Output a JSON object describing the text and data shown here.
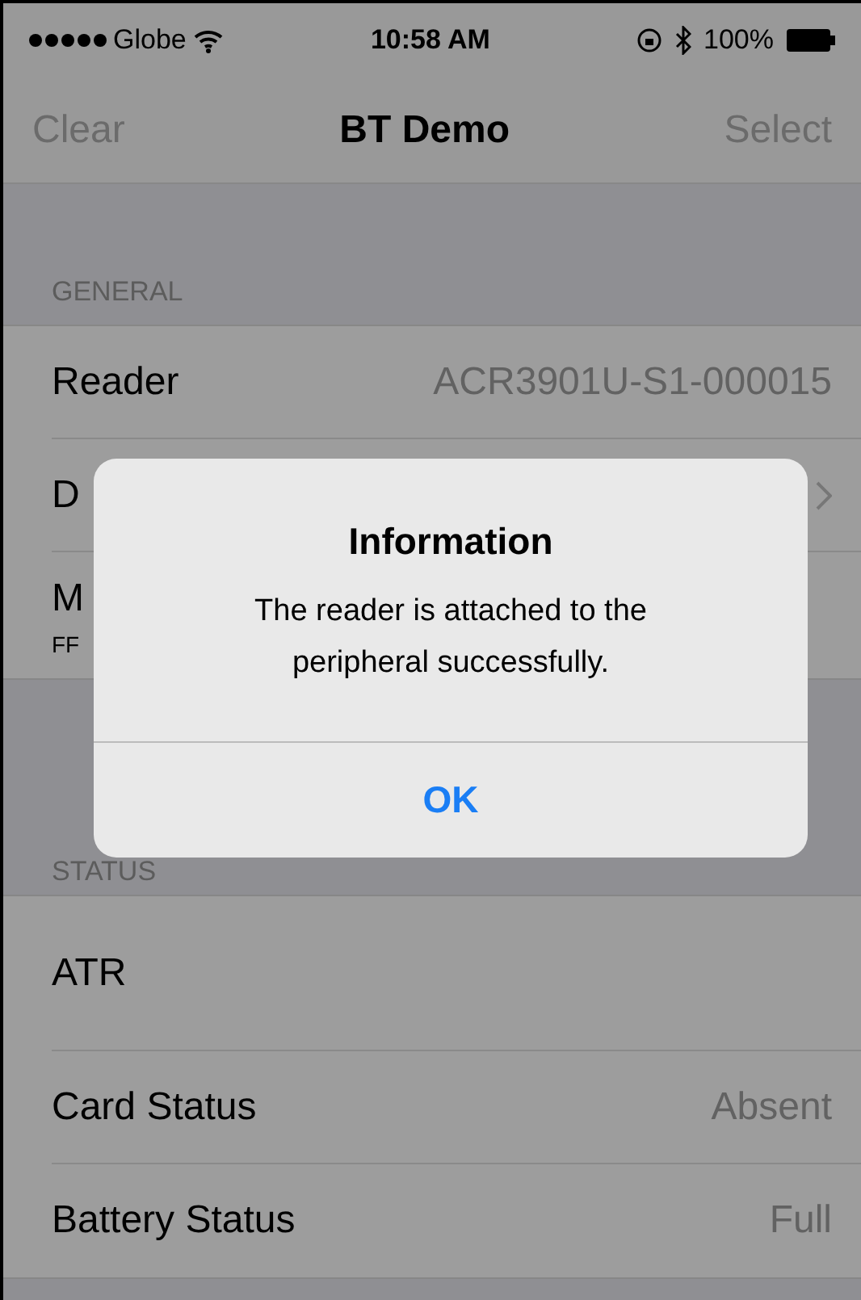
{
  "status_bar": {
    "carrier": "Globe",
    "time": "10:58 AM",
    "battery": "100%"
  },
  "nav": {
    "left": "Clear",
    "title": "BT Demo",
    "right": "Select"
  },
  "sections": [
    {
      "header": "GENERAL",
      "rows": [
        {
          "label": "Reader",
          "value": "ACR3901U-S1-000015",
          "chevron": false
        },
        {
          "label": "D",
          "chevron": true
        },
        {
          "label": "M",
          "subtitle": "FF",
          "chevron": false
        }
      ]
    },
    {
      "header": "STATUS",
      "rows": [
        {
          "label": "ATR",
          "chevron": false,
          "tall": true
        },
        {
          "label": "Card Status",
          "value": "Absent",
          "chevron": false
        },
        {
          "label": "Battery Status",
          "value": "Full",
          "chevron": false
        }
      ]
    }
  ],
  "alert": {
    "title": "Information",
    "message": "The reader is attached to the peripheral successfully.",
    "button": "OK"
  }
}
